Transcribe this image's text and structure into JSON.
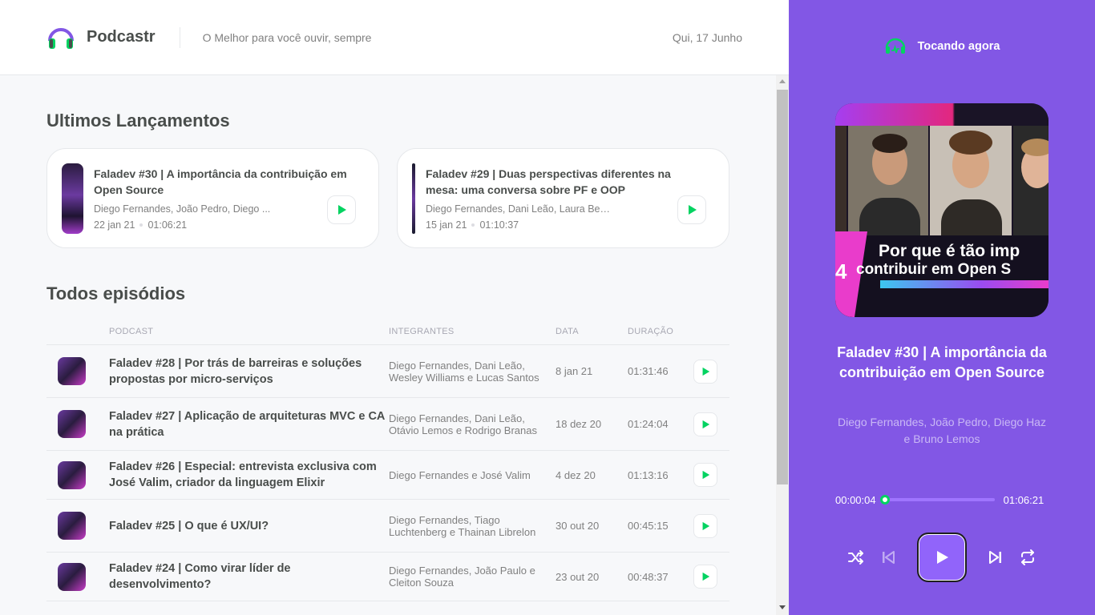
{
  "header": {
    "logo_text": "Podcastr",
    "tagline": "O Melhor para você ouvir, sempre",
    "date": "Qui, 17 Junho"
  },
  "latest": {
    "title": "Ultimos Lançamentos",
    "episodes": [
      {
        "title": "Faladev #30 | A importância da contribuição em Open Source",
        "members": "Diego Fernandes, João Pedro, Diego ...",
        "date": "22 jan 21",
        "duration": "01:06:21"
      },
      {
        "title": "Faladev #29 | Duas perspectivas diferentes na mesa: uma conversa sobre PF e OOP",
        "members": "Diego Fernandes, Dani Leão, Laura Beat...",
        "date": "15 jan 21",
        "duration": "01:10:37"
      }
    ]
  },
  "all": {
    "title": "Todos episódios",
    "columns": [
      "Podcast",
      "Integrantes",
      "Data",
      "Duração"
    ],
    "rows": [
      {
        "title": "Faladev #28 | Por trás de barreiras e soluções propostas por micro-serviços",
        "members": "Diego Fernandes, Dani Leão, Wesley Williams e Lucas Santos",
        "date": "8 jan 21",
        "duration": "01:31:46"
      },
      {
        "title": "Faladev #27 | Aplicação de arquiteturas MVC e CA na prática",
        "members": "Diego Fernandes, Dani Leão, Otávio Lemos e Rodrigo Branas",
        "date": "18 dez 20",
        "duration": "01:24:04"
      },
      {
        "title": "Faladev #26 | Especial: entrevista exclusiva com José Valim, criador da linguagem Elixir",
        "members": "Diego Fernandes e José Valim",
        "date": "4 dez 20",
        "duration": "01:13:16"
      },
      {
        "title": "Faladev #25 | O que é UX/UI?",
        "members": "Diego Fernandes, Tiago Luchtenberg e Thainan Librelon",
        "date": "30 out 20",
        "duration": "00:45:15"
      },
      {
        "title": "Faladev #24 | Como virar líder de desenvolvimento?",
        "members": "Diego Fernandes, João Paulo e Cleiton Souza",
        "date": "23 out 20",
        "duration": "00:48:37"
      }
    ]
  },
  "player": {
    "header": "Tocando agora",
    "cover_line1": "Por que é tão imp",
    "cover_line2": "contribuir em Open S",
    "cover_num": "4",
    "title": "Faladev #30 | A importância da contribuição em Open Source",
    "members": "Diego Fernandes, João Pedro, Diego Haz e Bruno Lemos",
    "current_time": "00:00:04",
    "total_time": "01:06:21",
    "progress": 0.001
  },
  "colors": {
    "brand": "#8257e5",
    "accent_green": "#04d361"
  },
  "icons": [
    "headphones-logo-icon",
    "play-icon",
    "playing-icon",
    "shuffle-icon",
    "previous-icon",
    "next-icon",
    "repeat-icon"
  ]
}
